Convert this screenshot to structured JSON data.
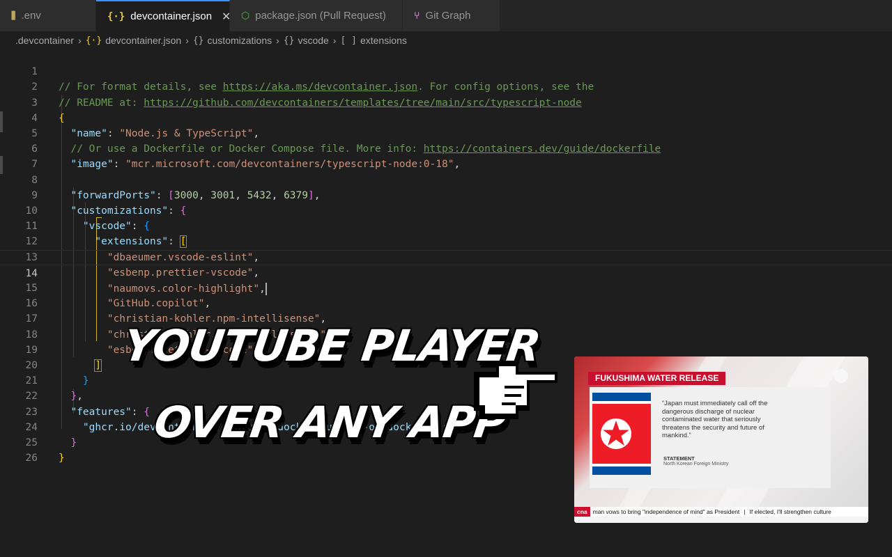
{
  "tabs": [
    {
      "label": ".env",
      "icon": "settings-sliders-icon",
      "icon_color": "#e8c94c"
    },
    {
      "label": "devcontainer.json",
      "icon": "json-braces-icon",
      "icon_color": "#e8c94c",
      "active": true
    },
    {
      "label": "package.json (Pull Request)",
      "icon": "nodejs-icon",
      "icon_color": "#3c873a"
    },
    {
      "label": "Git Graph",
      "icon": "git-graph-icon",
      "icon_color": "#c586c0"
    }
  ],
  "breadcrumb": [
    ".devcontainer",
    "devcontainer.json",
    "customizations",
    "vscode",
    "extensions"
  ],
  "breadcrumb_icons": {
    "file": "{·}",
    "obj1": "{}",
    "obj2": "{}",
    "arr": "[ ]"
  },
  "editor": {
    "current_line": 14,
    "line_numbers": [
      "1",
      "2",
      "3",
      "4",
      "5",
      "6",
      "7",
      "8",
      "9",
      "10",
      "11",
      "12",
      "13",
      "14",
      "15",
      "16",
      "17",
      "18",
      "19",
      "20",
      "21",
      "22",
      "23",
      "24",
      "25",
      "26"
    ],
    "line1_comment": "// For format details, see ",
    "line1_link": "https://aka.ms/devcontainer.json",
    "line1_tail": ". For config options, see the",
    "line2_comment": "// README at: ",
    "line2_link": "https://github.com/devcontainers/templates/tree/main/src/typescript-node",
    "name_key": "\"name\"",
    "name_val": "\"Node.js & TypeScript\"",
    "line5_comment": "// Or use a Dockerfile or Docker Compose file. More info: ",
    "line5_link": "https://containers.dev/guide/dockerfile",
    "image_key": "\"image\"",
    "image_val": "\"mcr.microsoft.com/devcontainers/typescript-node:0-18\"",
    "ports_key": "\"forwardPorts\"",
    "ports": [
      "3000",
      "3001",
      "5432",
      "6379"
    ],
    "customizations_key": "\"customizations\"",
    "vscode_key": "\"vscode\"",
    "extensions_key": "\"extensions\"",
    "extensions": [
      "\"dbaeumer.vscode-eslint\"",
      "\"esbenp.prettier-vscode\"",
      "\"naumovs.color-highlight\"",
      "\"GitHub.copilot\"",
      "\"christian-kohler.npm-intellisense\"",
      "\"christian-kohler.path-intellisense\"",
      "\"esbenp.prettier-vscode\""
    ],
    "features_key": "\"features\"",
    "feature_item_key": "\"ghcr.io/devcontainers/features/docker-outside-of-docker:1\""
  },
  "overlay": {
    "headline_line1": "YOUTUBE PLAYER",
    "headline_line2": "OVER ANY APP",
    "pointer": "pointing-hand-icon"
  },
  "player": {
    "tag": "FUKUSHIMA WATER RELEASE",
    "quote": "“Japan must immediately call off the dangerous discharge of nuclear contaminated water that seriously threatens the security and future of mankind.”",
    "statement_label": "STATEMENT",
    "statement_source": "North Korean Foreign Ministry",
    "ticker_logo": "cna",
    "ticker_text": "man vows to bring \"independence of mind\" as President",
    "ticker_text2": "If elected, I'll strengthen culture",
    "colors": {
      "brand_red": "#c8102e"
    }
  }
}
